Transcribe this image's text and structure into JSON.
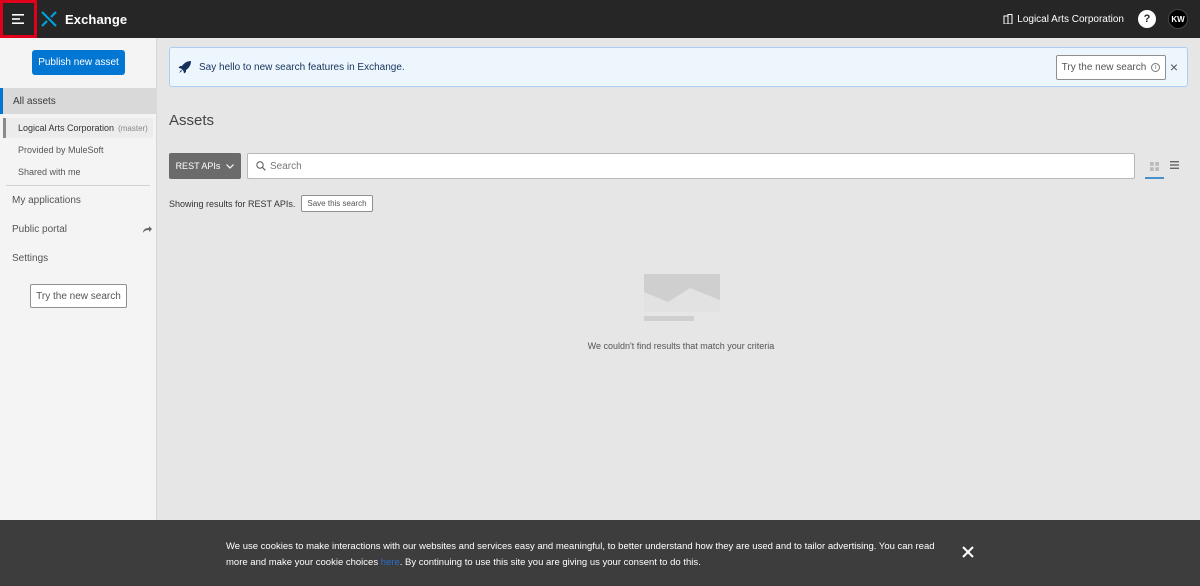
{
  "topbar": {
    "app_name": "Exchange",
    "org_name": "Logical Arts Corporation",
    "help_label": "?",
    "user_initials": "KW"
  },
  "sidebar": {
    "publish_label": "Publish new asset",
    "all_assets": "All assets",
    "sub_items": [
      {
        "label": "Logical Arts Corporation",
        "note": "(master)"
      },
      {
        "label": "Provided by MuleSoft"
      },
      {
        "label": "Shared with me"
      }
    ],
    "items": [
      {
        "label": "My applications"
      },
      {
        "label": "Public portal"
      },
      {
        "label": "Settings"
      }
    ],
    "try_new_search": "Try the new search"
  },
  "banner": {
    "message": "Say hello to new search features in Exchange.",
    "try_label": "Try the new search"
  },
  "main": {
    "title": "Assets",
    "type_filter": "REST APIs",
    "search_placeholder": "Search",
    "results_text": "Showing results for REST APIs.",
    "save_search_label": "Save this search",
    "empty_text": "We couldn't find results that match your criteria"
  },
  "cookie": {
    "text_before": "We use cookies to make interactions with our websites and services easy and meaningful, to better understand how they are used and to tailor advertising. You can read more and make your cookie choices ",
    "link_text": "here",
    "text_after": ". By continuing to use this site you are giving us your consent to do this."
  },
  "colors": {
    "accent": "#0176d3",
    "topbar": "#262626",
    "cookie_bg": "#3d3d3d",
    "highlight": "#e0001b"
  }
}
